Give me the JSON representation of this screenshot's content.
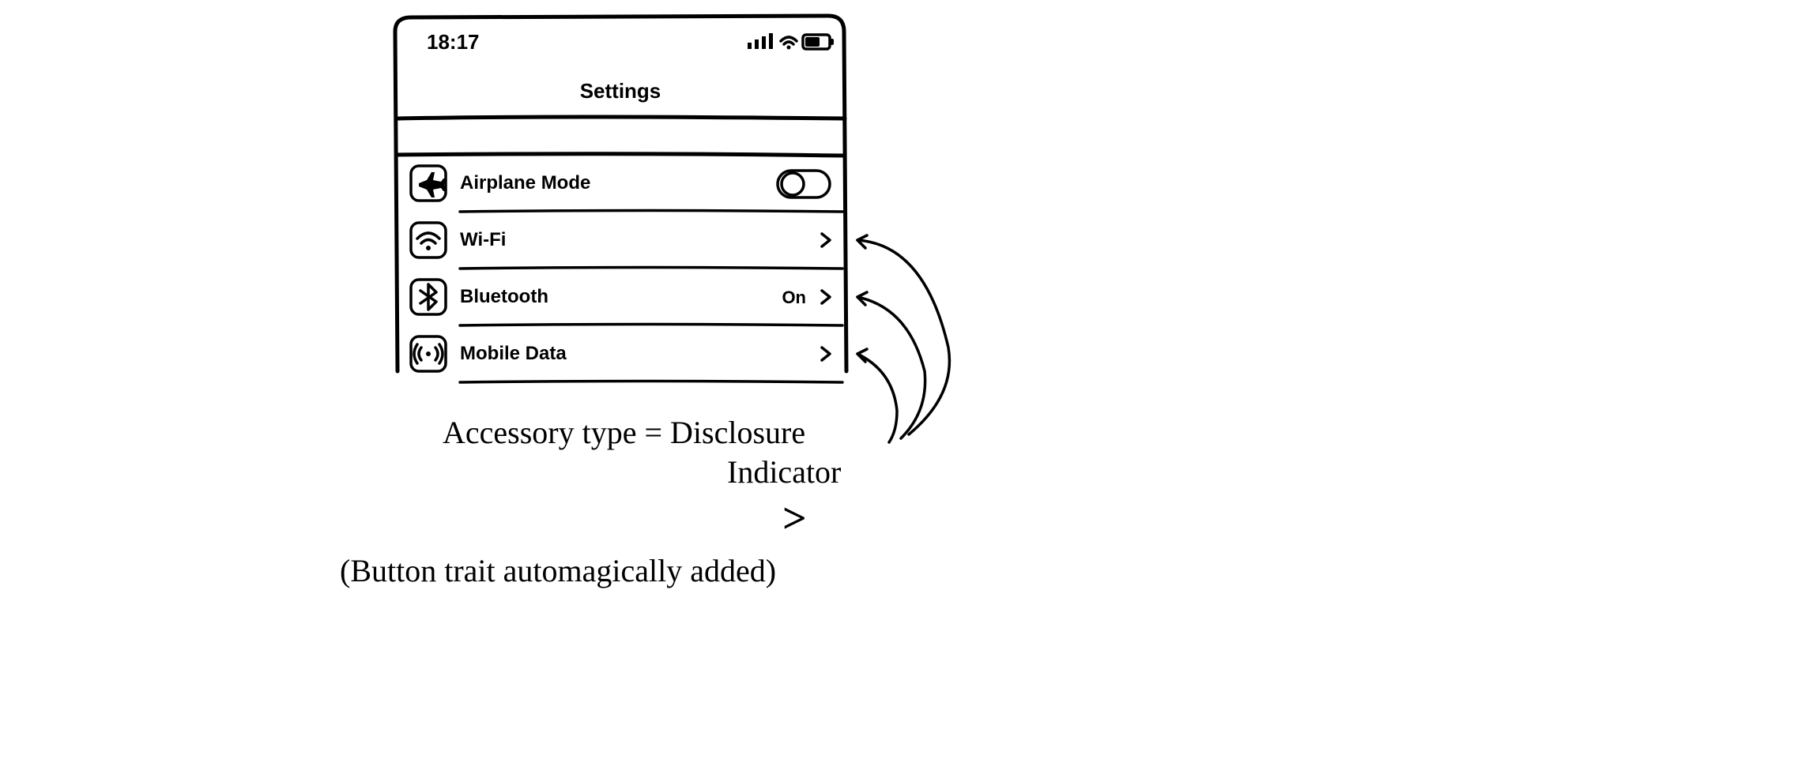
{
  "statusbar": {
    "time": "18:17"
  },
  "header": {
    "title": "Settings"
  },
  "rows": {
    "airplane": {
      "label": "Airplane Mode"
    },
    "wifi": {
      "label": "Wi-Fi"
    },
    "bluetooth": {
      "label": "Bluetooth",
      "value": "On"
    },
    "mobile": {
      "label": "Mobile Data"
    }
  },
  "annotations": {
    "line1": "Accessory type = Disclosure",
    "line2": "Indicator",
    "chevron": ">",
    "line3": "(Button trait automagically added)"
  }
}
